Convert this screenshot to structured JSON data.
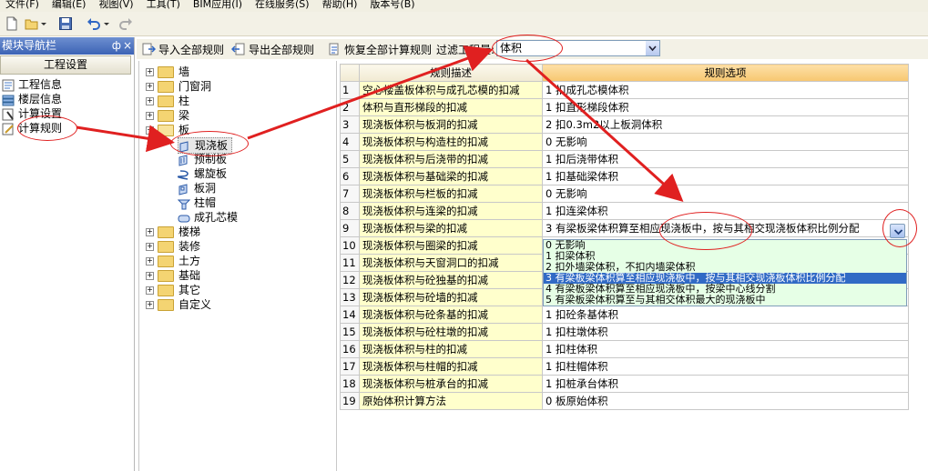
{
  "menu": [
    "文件(F)",
    "编辑(E)",
    "视图(V)",
    "工具(T)",
    "BIM应用(I)",
    "在线服务(S)",
    "帮助(H)",
    "版本号(B)"
  ],
  "toolbar": {
    "import_label": "导入全部规则",
    "export_label": "导出全部规则",
    "restore_label": "恢复全部计算规则",
    "filter_label": "过滤工程量:",
    "filter_value": "体积"
  },
  "nav": {
    "title": "模块导航栏",
    "pin": "ф",
    "close": "×",
    "button": "工程设置",
    "items": [
      "工程信息",
      "楼层信息",
      "计算设置",
      "计算规则"
    ]
  },
  "tree": {
    "top": [
      "墙",
      "门窗洞",
      "柱",
      "梁",
      "板"
    ],
    "board_children": [
      "现浇板",
      "预制板",
      "螺旋板",
      "板洞",
      "柱帽",
      "成孔芯模"
    ],
    "bottom": [
      "楼梯",
      "装修",
      "土方",
      "基础",
      "其它",
      "自定义"
    ]
  },
  "table": {
    "col_desc": "规则描述",
    "col_option": "规则选项",
    "rows": [
      {
        "n": "1",
        "desc": "空心楼盖板体积与成孔芯模的扣减",
        "val": "1  扣成孔芯模体积"
      },
      {
        "n": "2",
        "desc": "体积与直形梯段的扣减",
        "val": "1  扣直形梯段体积"
      },
      {
        "n": "3",
        "desc": "现浇板体积与板洞的扣减",
        "val": "2   扣0.3m2以上板洞体积"
      },
      {
        "n": "4",
        "desc": "现浇板体积与构造柱的扣减",
        "val": "0   无影响"
      },
      {
        "n": "5",
        "desc": "现浇板体积与后浇带的扣减",
        "val": "1   扣后浇带体积"
      },
      {
        "n": "6",
        "desc": "现浇板体积与基础梁的扣减",
        "val": "1   扣基础梁体积"
      },
      {
        "n": "7",
        "desc": "现浇板体积与栏板的扣减",
        "val": "0   无影响"
      },
      {
        "n": "8",
        "desc": "现浇板体积与连梁的扣减",
        "val": "1   扣连梁体积"
      },
      {
        "n": "9",
        "desc": "现浇板体积与梁的扣减",
        "val": "3   有梁板梁体积算至相应现浇板中，按与其相交现浇板体积比例分配"
      },
      {
        "n": "10",
        "desc": "现浇板体积与圈梁的扣减",
        "val": ""
      },
      {
        "n": "11",
        "desc": "现浇板体积与天窗洞口的扣减",
        "val": ""
      },
      {
        "n": "12",
        "desc": "现浇板体积与砼独基的扣减",
        "val": ""
      },
      {
        "n": "13",
        "desc": "现浇板体积与砼墙的扣减",
        "val": ""
      },
      {
        "n": "14",
        "desc": "现浇板体积与砼条基的扣减",
        "val": "1   扣砼条基体积"
      },
      {
        "n": "15",
        "desc": "现浇板体积与砼柱墩的扣减",
        "val": "1   扣柱墩体积"
      },
      {
        "n": "16",
        "desc": "现浇板体积与柱的扣减",
        "val": "1   扣柱体积"
      },
      {
        "n": "17",
        "desc": "现浇板体积与柱帽的扣减",
        "val": "1   扣柱帽体积"
      },
      {
        "n": "18",
        "desc": "现浇板体积与桩承台的扣减",
        "val": "1   扣桩承台体积"
      },
      {
        "n": "19",
        "desc": "原始体积计算方法",
        "val": "0  板原始体积"
      }
    ]
  },
  "dropdown": {
    "selected_index": 3,
    "options": [
      "0   无影响",
      "1   扣梁体积",
      "2   扣外墙梁体积，不扣内墙梁体积",
      "3   有梁板梁体积算至相应现浇板中，按与其相交现浇板体积比例分配",
      "4   有梁板梁体积算至相应现浇板中，按梁中心线分割",
      "5   有梁板梁体积算至与其相交体积最大的现浇板中"
    ]
  },
  "colors": {
    "accent_annotation": "#e02020",
    "header_option_bg": "#f7c770",
    "desc_bg": "#ffffcc",
    "selection_bg": "#316ac5",
    "dropdown_bg": "#e6ffe6"
  }
}
